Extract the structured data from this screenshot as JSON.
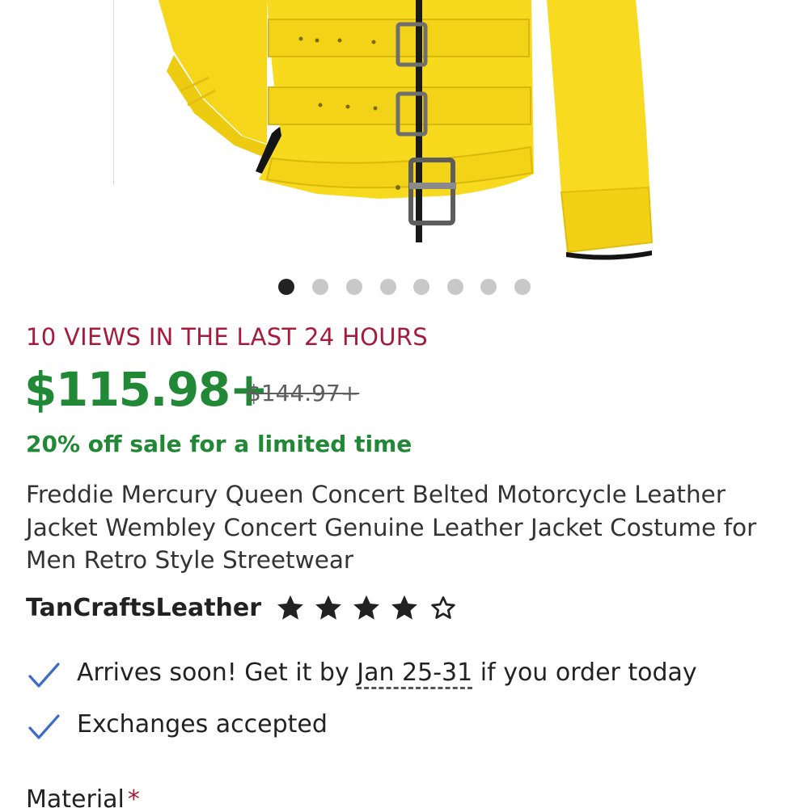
{
  "gallery": {
    "image_alt": "Yellow belted leather jacket",
    "slide_count": 8,
    "active_slide": 1
  },
  "listing": {
    "views_notice": "10 VIEWS IN THE LAST 24 HOURS",
    "price": "$115.98+",
    "original_price": "$144.97+",
    "sale_text": "20% off sale for a limited time",
    "title": "Freddie Mercury Queen Concert Belted Motorcycle Leather Jacket Wembley Concert Genuine Leather Jacket Costume for Men Retro Style Streetwear"
  },
  "shop": {
    "name": "TanCraftsLeather",
    "rating": 4,
    "rating_max": 5
  },
  "features": {
    "arrival_prefix": "Arrives soon! Get it by ",
    "arrival_dates": "Jan 25-31",
    "arrival_suffix": " if you order today",
    "exchanges": "Exchanges accepted"
  },
  "options": {
    "material_label": "Material",
    "required_marker": "*"
  },
  "colors": {
    "price_green": "#218836",
    "alert_red": "#a61a3c",
    "check_blue": "#3b6cc9"
  }
}
